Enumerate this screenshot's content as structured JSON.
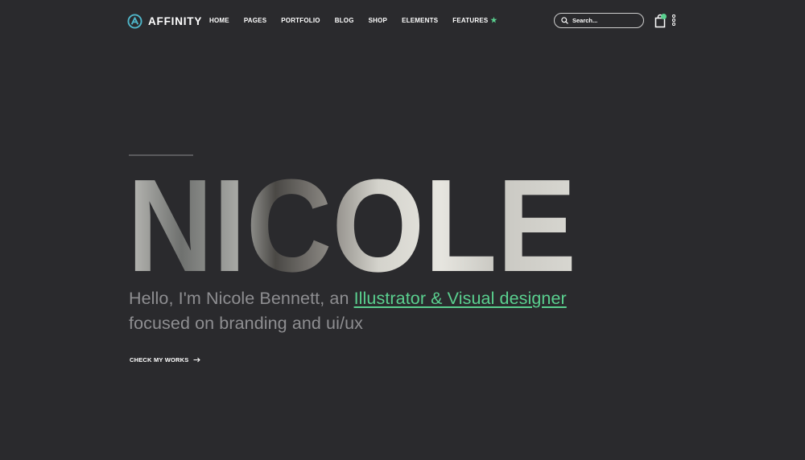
{
  "brand": {
    "name": "AFFINITY",
    "logo_icon": "affinity-logo-icon",
    "accent": "#5ad08f"
  },
  "nav": {
    "items": [
      {
        "label": "HOME"
      },
      {
        "label": "PAGES"
      },
      {
        "label": "PORTFOLIO"
      },
      {
        "label": "BLOG"
      },
      {
        "label": "SHOP"
      },
      {
        "label": "ELEMENTS"
      },
      {
        "label": "FEATURES",
        "icon": "star-icon"
      }
    ],
    "star_glyph": "★"
  },
  "search": {
    "placeholder": "Search...",
    "icon": "search-icon"
  },
  "cart": {
    "icon": "shopping-bag-icon",
    "badge_color": "#5ad08f"
  },
  "menu": {
    "icon": "vertical-dots-icon"
  },
  "hero": {
    "name": "NICOLE",
    "intro_prefix": "Hello, I'm Nicole Bennett, an ",
    "intro_highlight": "Illustrator & Visual designer",
    "intro_line2": "focused on branding and ui/ux",
    "cta_label": "CHECK MY WORKS",
    "cta_icon": "arrow-right-icon"
  },
  "colors": {
    "background": "#2a2a2d",
    "text": "#ffffff",
    "muted": "#8e8e91",
    "accent": "#5ad08f"
  }
}
